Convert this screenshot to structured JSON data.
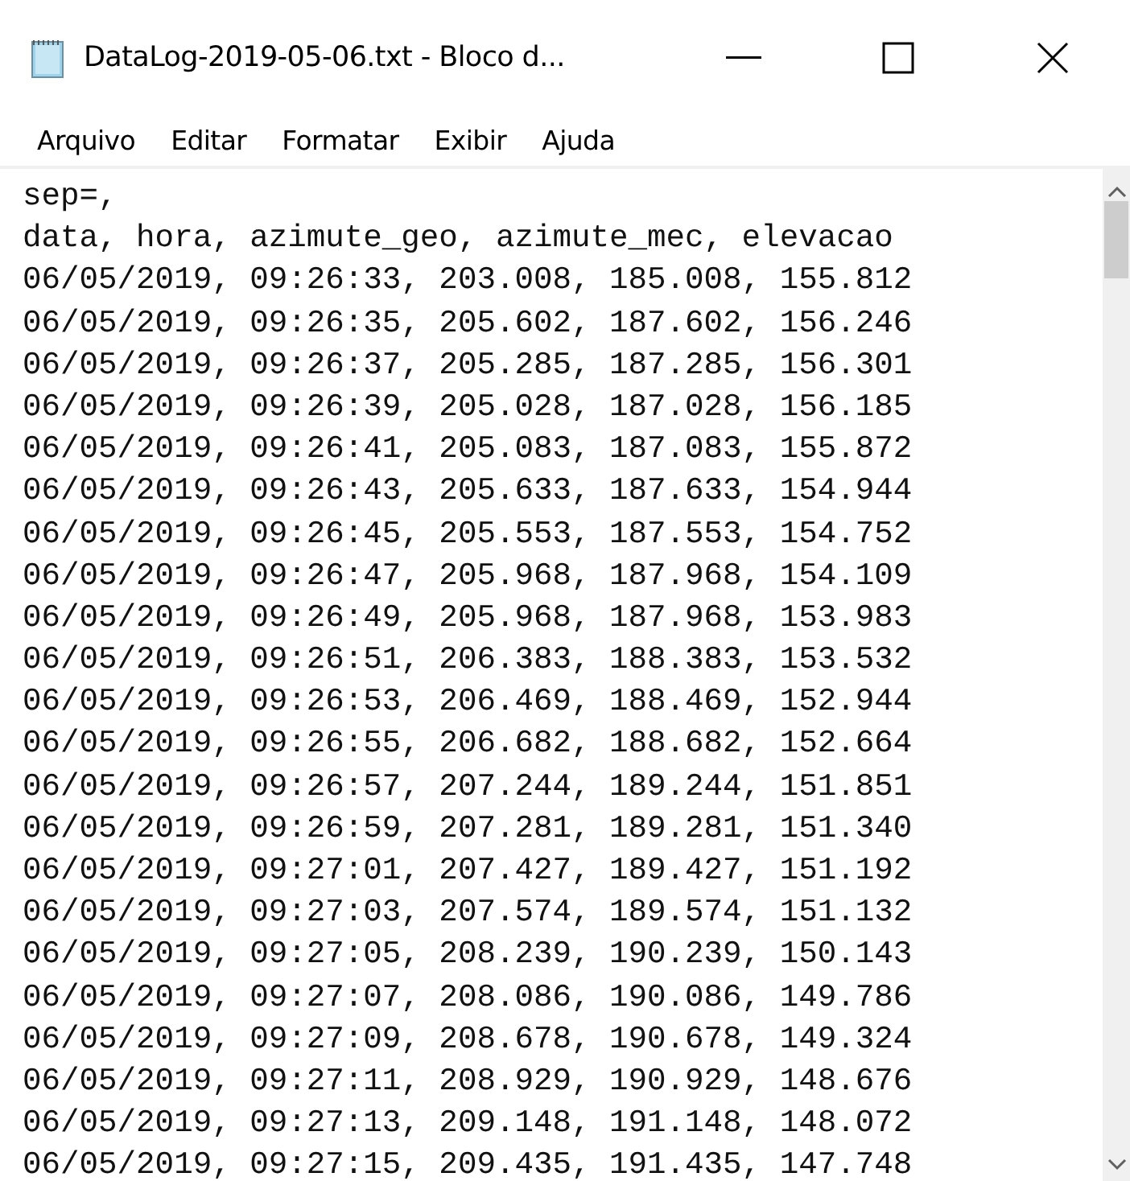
{
  "window": {
    "title": "DataLog-2019-05-06.txt - Bloco d..."
  },
  "menu": [
    "Arquivo",
    "Editar",
    "Formatar",
    "Exibir",
    "Ajuda"
  ],
  "editor": {
    "lines": [
      "sep=,",
      "data, hora, azimute_geo, azimute_mec, elevacao",
      "06/05/2019, 09:26:33, 203.008, 185.008, 155.812",
      "06/05/2019, 09:26:35, 205.602, 187.602, 156.246",
      "06/05/2019, 09:26:37, 205.285, 187.285, 156.301",
      "06/05/2019, 09:26:39, 205.028, 187.028, 156.185",
      "06/05/2019, 09:26:41, 205.083, 187.083, 155.872",
      "06/05/2019, 09:26:43, 205.633, 187.633, 154.944",
      "06/05/2019, 09:26:45, 205.553, 187.553, 154.752",
      "06/05/2019, 09:26:47, 205.968, 187.968, 154.109",
      "06/05/2019, 09:26:49, 205.968, 187.968, 153.983",
      "06/05/2019, 09:26:51, 206.383, 188.383, 153.532",
      "06/05/2019, 09:26:53, 206.469, 188.469, 152.944",
      "06/05/2019, 09:26:55, 206.682, 188.682, 152.664",
      "06/05/2019, 09:26:57, 207.244, 189.244, 151.851",
      "06/05/2019, 09:26:59, 207.281, 189.281, 151.340",
      "06/05/2019, 09:27:01, 207.427, 189.427, 151.192",
      "06/05/2019, 09:27:03, 207.574, 189.574, 151.132",
      "06/05/2019, 09:27:05, 208.239, 190.239, 150.143",
      "06/05/2019, 09:27:07, 208.086, 190.086, 149.786",
      "06/05/2019, 09:27:09, 208.678, 190.678, 149.324",
      "06/05/2019, 09:27:11, 208.929, 190.929, 148.676",
      "06/05/2019, 09:27:13, 209.148, 191.148, 148.072",
      "06/05/2019, 09:27:15, 209.435, 191.435, 147.748"
    ]
  }
}
